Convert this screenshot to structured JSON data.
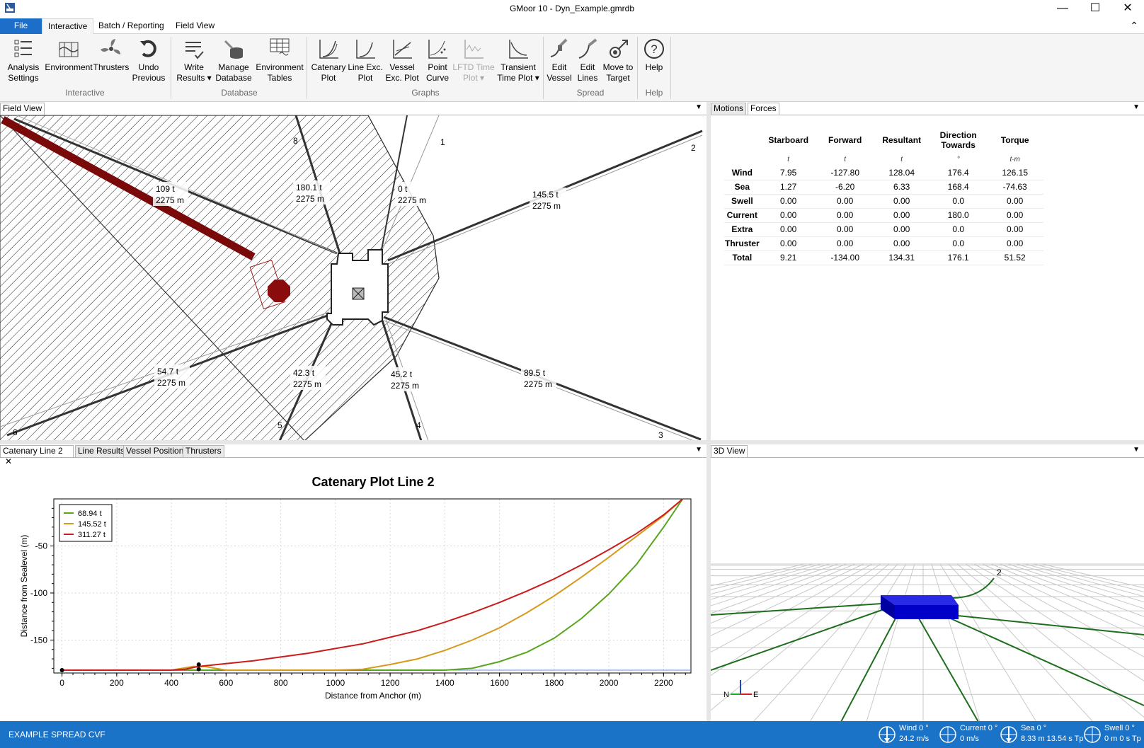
{
  "window": {
    "title": "GMoor 10 - Dyn_Example.gmrdb",
    "minimize": "—",
    "maximize": "☐",
    "close": "✕"
  },
  "ribbon": {
    "tabs": [
      "File",
      "Interactive",
      "Batch / Reporting",
      "Field View"
    ],
    "groups": {
      "interactive": "Interactive",
      "database": "Database",
      "graphs": "Graphs",
      "spread": "Spread",
      "help": "Help"
    },
    "buttons": {
      "analysis_settings": [
        "Analysis",
        "Settings"
      ],
      "environment": [
        "Environment",
        ""
      ],
      "thrusters": [
        "Thrusters",
        ""
      ],
      "undo_previous": [
        "Undo",
        "Previous"
      ],
      "write_results": [
        "Write",
        "Results ▾"
      ],
      "manage_database": [
        "Manage",
        "Database"
      ],
      "environment_tables": [
        "Environment",
        "Tables"
      ],
      "catenary_plot": [
        "Catenary",
        "Plot"
      ],
      "line_exc_plot": [
        "Line Exc.",
        "Plot"
      ],
      "vessel_exc_plot": [
        "Vessel",
        "Exc. Plot"
      ],
      "point_curve": [
        "Point",
        "Curve"
      ],
      "lftd_time_plot": [
        "LFTD Time",
        "Plot ▾"
      ],
      "transient_time_plot": [
        "Transient",
        "Time Plot ▾"
      ],
      "edit_vessel": [
        "Edit",
        "Vessel"
      ],
      "edit_lines": [
        "Edit",
        "Lines"
      ],
      "move_to_target": [
        "Move to",
        "Target"
      ],
      "help": [
        "Help",
        ""
      ]
    }
  },
  "field_view": {
    "tab": "Field View",
    "line_numbers": [
      "1",
      "2",
      "3",
      "4",
      "5",
      "6",
      "8"
    ],
    "labels": [
      {
        "t": "109 t",
        "m": "2275 m"
      },
      {
        "t": "180.1 t",
        "m": "2275 m"
      },
      {
        "t": "0 t",
        "m": "2275 m"
      },
      {
        "t": "145.5 t",
        "m": "2275 m"
      },
      {
        "t": "54.7 t",
        "m": "2275 m"
      },
      {
        "t": "42.3 t",
        "m": "2275 m"
      },
      {
        "t": "45.2 t",
        "m": "2275 m"
      },
      {
        "t": "89.5 t",
        "m": "2275 m"
      }
    ]
  },
  "forces_panel": {
    "tabs": [
      "Motions",
      "Forces"
    ],
    "headers": [
      "Starboard",
      "Forward",
      "Resultant",
      "Direction Towards",
      "Torque"
    ],
    "units": [
      "t",
      "t",
      "t",
      "°",
      "t·m"
    ],
    "rows": [
      {
        "name": "Wind",
        "values": [
          "7.95",
          "-127.80",
          "128.04",
          "176.4",
          "126.15"
        ]
      },
      {
        "name": "Sea",
        "values": [
          "1.27",
          "-6.20",
          "6.33",
          "168.4",
          "-74.63"
        ]
      },
      {
        "name": "Swell",
        "values": [
          "0.00",
          "0.00",
          "0.00",
          "0.0",
          "0.00"
        ]
      },
      {
        "name": "Current",
        "values": [
          "0.00",
          "0.00",
          "0.00",
          "180.0",
          "0.00"
        ]
      },
      {
        "name": "Extra",
        "values": [
          "0.00",
          "0.00",
          "0.00",
          "0.0",
          "0.00"
        ]
      },
      {
        "name": "Thruster",
        "values": [
          "0.00",
          "0.00",
          "0.00",
          "0.0",
          "0.00"
        ]
      },
      {
        "name": "Total",
        "values": [
          "9.21",
          "-134.00",
          "134.31",
          "176.1",
          "51.52"
        ]
      }
    ]
  },
  "bottom_tabs": [
    "Catenary Line 2",
    "Line Results",
    "Vessel Position",
    "Thrusters"
  ],
  "tab_close": "✕",
  "chart_data": {
    "type": "line",
    "title": "Catenary Plot Line 2",
    "xlabel": "Distance from Anchor (m)",
    "ylabel": "Distance from Sealevel (m)",
    "xlim": [
      -30,
      2300
    ],
    "ylim": [
      -185,
      0
    ],
    "xticks": [
      0,
      200,
      400,
      600,
      800,
      1000,
      1200,
      1400,
      1600,
      1800,
      2000,
      2200
    ],
    "yticks": [
      -50,
      -100,
      -150
    ],
    "grid": true,
    "legend_position": "top-left",
    "series": [
      {
        "name": "68.94 t",
        "color": "#5aa51e",
        "x": [
          0,
          400,
          500,
          600,
          1000,
          1400,
          1500,
          1600,
          1700,
          1800,
          1900,
          2000,
          2100,
          2200,
          2270
        ],
        "y": [
          -182,
          -182,
          -182,
          -182,
          -182,
          -182,
          -180,
          -173,
          -163,
          -148,
          -127,
          -101,
          -70,
          -30,
          0
        ]
      },
      {
        "name": "145.52 t",
        "color": "#d69a1a",
        "x": [
          0,
          400,
          480,
          520,
          600,
          1000,
          1100,
          1200,
          1300,
          1400,
          1500,
          1600,
          1700,
          1800,
          1900,
          2000,
          2100,
          2200,
          2270
        ],
        "y": [
          -182,
          -182,
          -178,
          -178,
          -182,
          -182,
          -181,
          -176,
          -170,
          -161,
          -150,
          -137,
          -121,
          -103,
          -83,
          -62,
          -40,
          -18,
          0
        ]
      },
      {
        "name": "311.27 t",
        "color": "#cc1b1b",
        "x": [
          0,
          400,
          450,
          500,
          600,
          700,
          800,
          900,
          1000,
          1100,
          1200,
          1300,
          1400,
          1500,
          1600,
          1700,
          1800,
          1900,
          2000,
          2100,
          2200,
          2270
        ],
        "y": [
          -182,
          -182,
          -181,
          -178,
          -175,
          -172,
          -168,
          -164,
          -159,
          -154,
          -147,
          -140,
          -131,
          -121,
          -110,
          -98,
          -85,
          -70,
          -54,
          -37,
          -17,
          0
        ]
      }
    ]
  },
  "view3d": {
    "tab": "3D View",
    "line_label": "2",
    "axis_labels": [
      "N",
      "E"
    ]
  },
  "status": {
    "spread_name": "EXAMPLE SPREAD CVF",
    "wind": {
      "l1": "Wind 0 °",
      "l2": "24.2 m/s"
    },
    "current": {
      "l1": "Current 0 °",
      "l2": "0 m/s"
    },
    "sea": {
      "l1": "Sea 0 °",
      "l2": "8.33 m 13.54 s Tp"
    },
    "swell": {
      "l1": "Swell 0 °",
      "l2": "0 m 0 s Tp"
    }
  }
}
